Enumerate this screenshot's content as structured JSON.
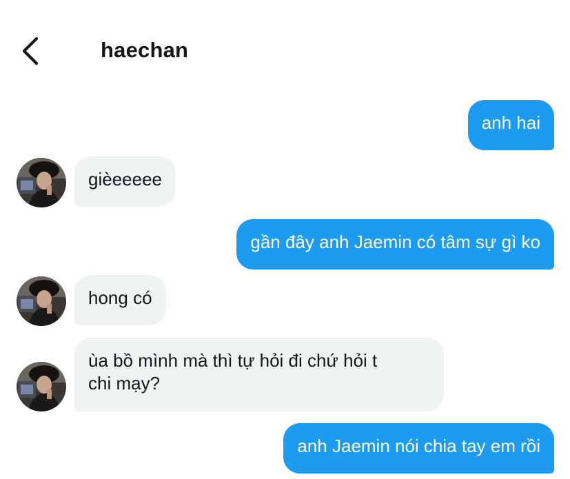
{
  "header": {
    "back_icon": "chevron-left-icon",
    "title": "haechan"
  },
  "messages": [
    {
      "from": "me",
      "text": "anh hai"
    },
    {
      "from": "them",
      "text": "gièeeeee"
    },
    {
      "from": "me",
      "text": "gần đây anh Jaemin có tâm sự gì ko"
    },
    {
      "from": "them",
      "text": "hong có"
    },
    {
      "from": "them",
      "text": "ùa bồ mình mà thì tự hỏi đi chứ hỏi t",
      "text2": "chi mạy?"
    },
    {
      "from": "me",
      "text": "anh Jaemin nói chia tay em rồi"
    }
  ],
  "colors": {
    "outgoing_bubble": "#1d9bf0",
    "incoming_bubble": "#eff3f4",
    "text_dark": "#14171a"
  }
}
